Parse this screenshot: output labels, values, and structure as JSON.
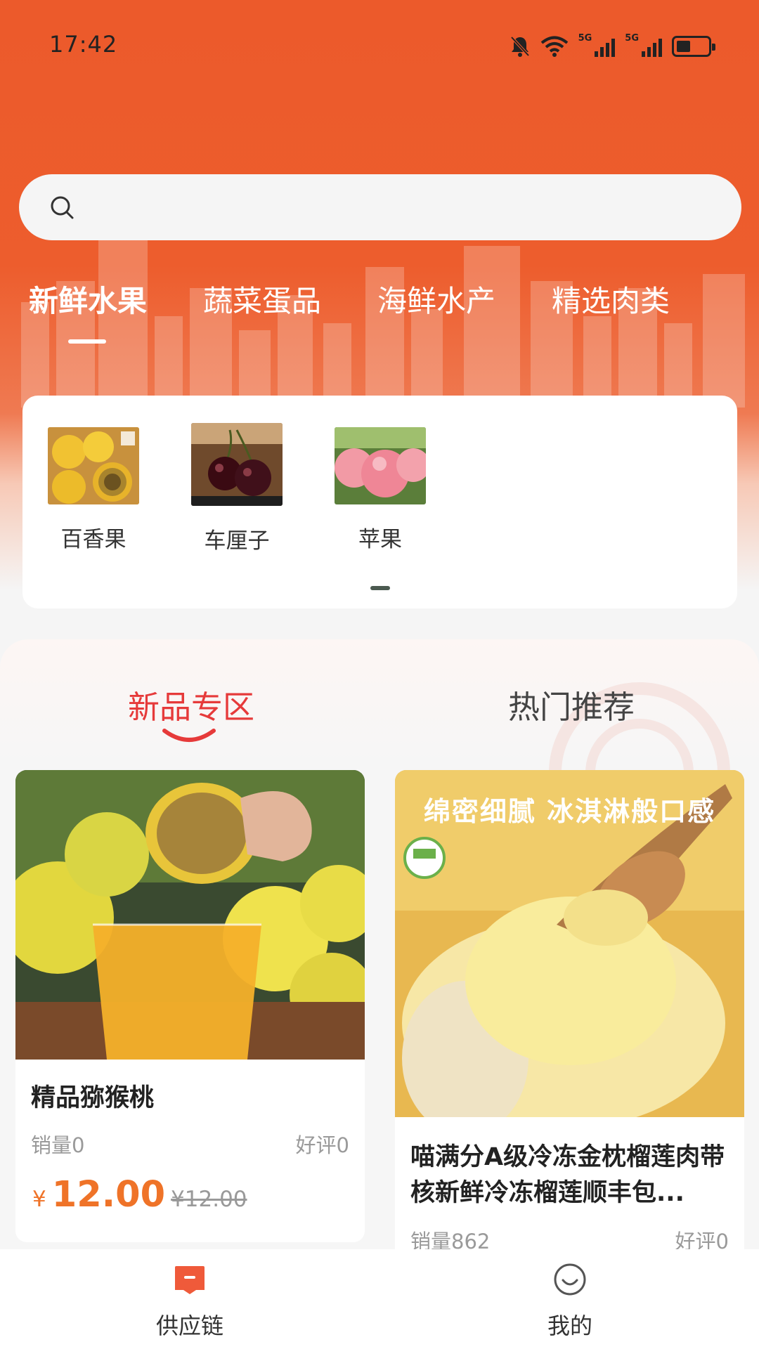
{
  "status_bar": {
    "time": "17:42",
    "signal_1": "5G",
    "signal_2": "5G",
    "icons": [
      "mute-bell-icon",
      "wifi-icon",
      "signal-icon",
      "signal-icon",
      "battery-icon"
    ],
    "battery_level": 0.45
  },
  "search": {
    "placeholder": ""
  },
  "category_tabs": [
    {
      "label": "新鲜水果",
      "active": true
    },
    {
      "label": "蔬菜蛋品",
      "active": false
    },
    {
      "label": "海鲜水产",
      "active": false
    },
    {
      "label": "精选肉类",
      "active": false
    }
  ],
  "subcategories": [
    {
      "label": "百香果"
    },
    {
      "label": "车厘子"
    },
    {
      "label": "苹果"
    }
  ],
  "section_tabs": [
    {
      "label": "新品专区",
      "active": true
    },
    {
      "label": "热门推荐",
      "active": false
    }
  ],
  "products": [
    {
      "title": "精品猕猴桃",
      "sales": "销量0",
      "reviews": "好评0",
      "currency": "¥",
      "price": "12.00",
      "old_price": "¥12.00"
    },
    {
      "title": "喵满分A级冷冻金枕榴莲肉带核新鲜冷冻榴莲顺丰包...",
      "image_caption": "绵密细腻 冰淇淋般口感",
      "sales": "销量862",
      "reviews": "好评0"
    }
  ],
  "bottom_nav": [
    {
      "label": "供应链",
      "icon": "supply-chain-icon",
      "active": true
    },
    {
      "label": "我的",
      "icon": "smiley-profile-icon",
      "active": false
    }
  ],
  "colors": {
    "brand": "#ec5a2b",
    "accent_red": "#e63a3a",
    "price_orange": "#ef7328"
  }
}
